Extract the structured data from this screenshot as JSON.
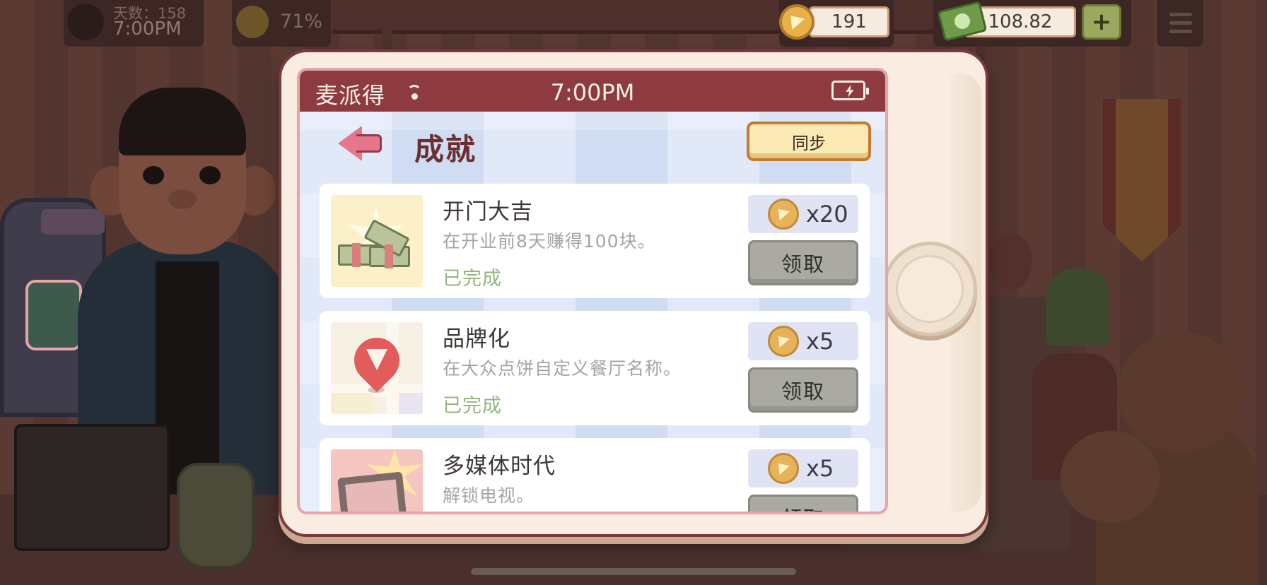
{
  "hud": {
    "day_label": "天数：158",
    "time": "7:00PM",
    "mood_pct": "71%",
    "coins": "191",
    "cash": "108.82",
    "add_label": "+"
  },
  "phone": {
    "carrier": "麦派得",
    "time": "7:00PM",
    "title": "成就",
    "sync_label": "同步"
  },
  "achievements": [
    {
      "name": "开门大吉",
      "desc": "在开业前8天赚得100块。",
      "status": "已完成",
      "reward": "x20",
      "claim_label": "领取",
      "icon": "cash-stack-icon"
    },
    {
      "name": "品牌化",
      "desc": "在大众点饼自定义餐厅名称。",
      "status": "已完成",
      "reward": "x5",
      "claim_label": "领取",
      "icon": "map-pin-pizza-icon"
    },
    {
      "name": "多媒体时代",
      "desc": "解锁电视。",
      "status": "",
      "reward": "x5",
      "claim_label": "领取",
      "icon": "tv-icon"
    }
  ],
  "colors": {
    "status_bar": "#8d3b40",
    "title": "#6b2d2d",
    "completed": "#94b67c",
    "claim_button": "#aaaaa2",
    "sync_button": "#fbeab4"
  }
}
